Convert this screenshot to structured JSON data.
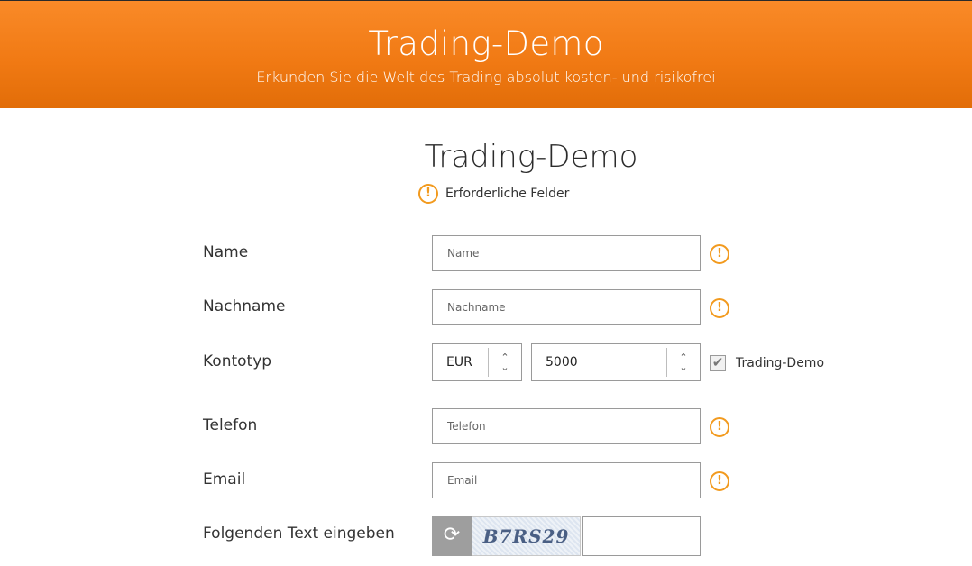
{
  "header": {
    "title": "Trading-Demo",
    "subtitle": "Erkunden Sie die Welt des Trading absolut kosten- und risikofrei"
  },
  "form": {
    "title": "Trading-Demo",
    "required_note": "Erforderliche Felder",
    "warn_glyph": "!",
    "fields": {
      "name": {
        "label": "Name",
        "placeholder": "Name"
      },
      "lastname": {
        "label": "Nachname",
        "placeholder": "Nachname"
      },
      "account": {
        "label": "Kontotyp",
        "currency": "EUR",
        "amount": "5000",
        "checkbox_label": "Trading-Demo",
        "checked": true
      },
      "phone": {
        "label": "Telefon",
        "placeholder": "Telefon"
      },
      "email": {
        "label": "Email",
        "placeholder": "Email"
      },
      "captcha": {
        "label": "Folgenden Text eingeben",
        "code": "B7RS29"
      }
    }
  },
  "icons": {
    "warning": "warning-circle-icon",
    "select_arrows": "updown-chevron-icon",
    "refresh": "refresh-icon",
    "check": "checkmark-icon"
  },
  "colors": {
    "header_orange": "#f17a14",
    "warning_orange": "#f29a1e",
    "refresh_gray": "#9e9e9e"
  }
}
